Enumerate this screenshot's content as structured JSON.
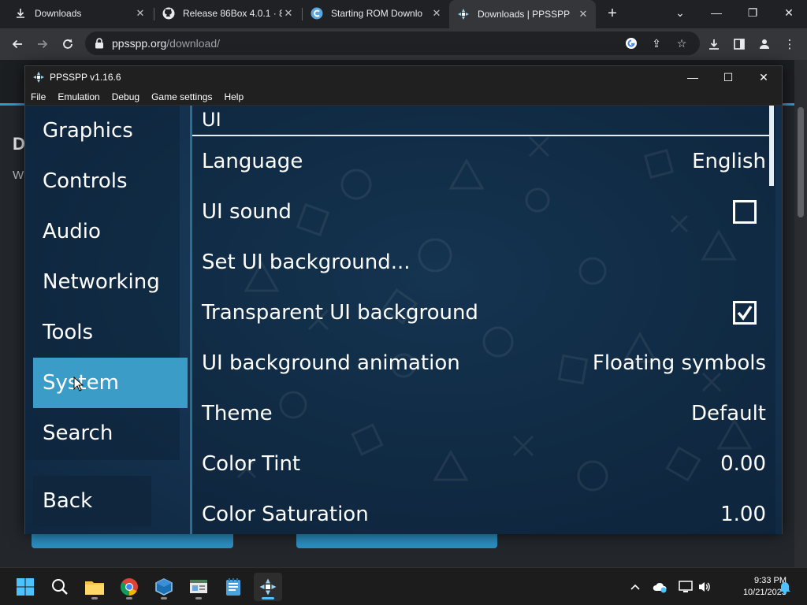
{
  "browser": {
    "tabs": [
      {
        "title": "Downloads",
        "icon": "download-icon"
      },
      {
        "title": "Release 86Box 4.0.1 · 8",
        "icon": "github-icon"
      },
      {
        "title": "Starting ROM Downlo",
        "icon": "site-icon"
      },
      {
        "title": "Downloads | PPSSPP",
        "icon": "ppsspp-icon"
      }
    ],
    "new_tab_label": "+",
    "url_host": "ppsspp.org",
    "url_path": "/download/"
  },
  "webpage": {
    "heading_fragment": "D",
    "paragraph_fragment": "W"
  },
  "ppsspp": {
    "window_title": "PPSSPP v1.16.6",
    "menu": [
      "File",
      "Emulation",
      "Debug",
      "Game settings",
      "Help"
    ],
    "categories": [
      "Graphics",
      "Controls",
      "Audio",
      "Networking",
      "Tools",
      "System",
      "Search"
    ],
    "selected_category": "System",
    "back_label": "Back",
    "section_title": "UI",
    "settings": [
      {
        "label": "Language",
        "value": "English"
      },
      {
        "label": "UI sound",
        "checked": false
      },
      {
        "label": "Set UI background..."
      },
      {
        "label": "Transparent UI background",
        "checked": true
      },
      {
        "label": "UI background animation",
        "value": "Floating symbols"
      },
      {
        "label": "Theme",
        "value": "Default"
      },
      {
        "label": "Color Tint",
        "value": "0.00"
      },
      {
        "label": "Color Saturation",
        "value": "1.00"
      }
    ],
    "colors": {
      "selected_category": "#3a9cc7",
      "background": "#163654"
    }
  },
  "taskbar": {
    "apps": [
      "start-icon",
      "search-icon",
      "file-explorer-icon",
      "chrome-icon",
      "virtualbox-icon",
      "app-icon",
      "notepad-icon",
      "ppsspp-icon"
    ],
    "time": "9:33 PM",
    "date": "10/21/2023"
  }
}
